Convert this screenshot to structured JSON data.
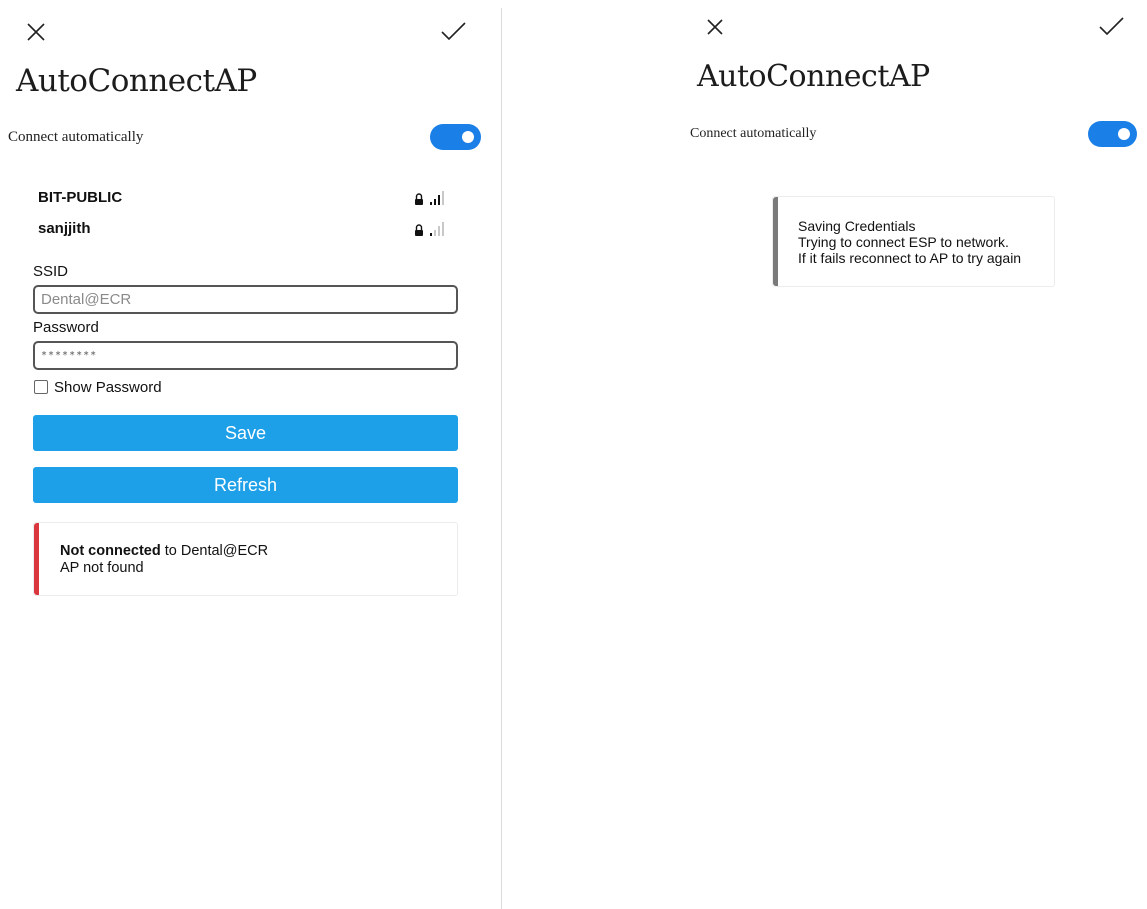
{
  "left_panel": {
    "title": "AutoConnectAP",
    "connect_label": "Connect automatically",
    "toggle_on": true,
    "networks": [
      {
        "name": "BIT-PUBLIC",
        "locked": true,
        "signal_bars": 3
      },
      {
        "name": "sanjjith",
        "locked": true,
        "signal_bars": 1
      }
    ],
    "ssid_label": "SSID",
    "ssid_placeholder": "Dental@ECR",
    "password_label": "Password",
    "password_value": "********",
    "show_password_label": "Show Password",
    "show_password_checked": false,
    "save_label": "Save",
    "refresh_label": "Refresh",
    "status": {
      "strong": "Not connected",
      "rest": " to Dental@ECR",
      "detail": "AP not found",
      "accent_color": "#d9363e"
    }
  },
  "right_panel": {
    "title": "AutoConnectAP",
    "connect_label": "Connect automatically",
    "toggle_on": true,
    "message_lines": [
      "Saving Credentials",
      "Trying to connect ESP to network.",
      "If it fails reconnect to AP to try again"
    ],
    "accent_color": "#7a7a7a"
  },
  "colors": {
    "toggle": "#1a7fe6",
    "button": "#1ea0e8"
  }
}
